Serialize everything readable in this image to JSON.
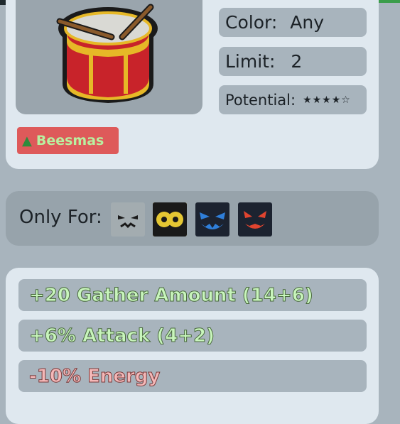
{
  "item": {
    "color_label": "Color:",
    "color_value": "Any",
    "limit_label": "Limit:",
    "limit_value": "2",
    "potential_label": "Potential:",
    "potential_stars": "★★★★☆",
    "potential_rating": 4,
    "potential_max": 5
  },
  "badge": {
    "label": "Beesmas",
    "icon": "christmas-tree-icon"
  },
  "only_for": {
    "label": "Only For:",
    "bees": [
      {
        "icon": "gray-bee-icon",
        "color": "#a3acb0"
      },
      {
        "icon": "yellow-bee-icon",
        "color": "#e5c733"
      },
      {
        "icon": "blue-bee-icon",
        "color": "#2f7fd9"
      },
      {
        "icon": "red-bee-icon",
        "color": "#e0442f"
      }
    ]
  },
  "stats": [
    {
      "text": "+20 Gather Amount (14+6)",
      "kind": "positive"
    },
    {
      "text": "+6% Attack (4+2)",
      "kind": "positive"
    },
    {
      "text": "-10% Energy",
      "kind": "negative"
    }
  ],
  "colors": {
    "background": "#a8b4bd",
    "panel": "#dfe8ef",
    "badge_bg": "#de5a5a",
    "positive_text": "#c8f5bc",
    "negative_text": "#f4b8b8"
  }
}
